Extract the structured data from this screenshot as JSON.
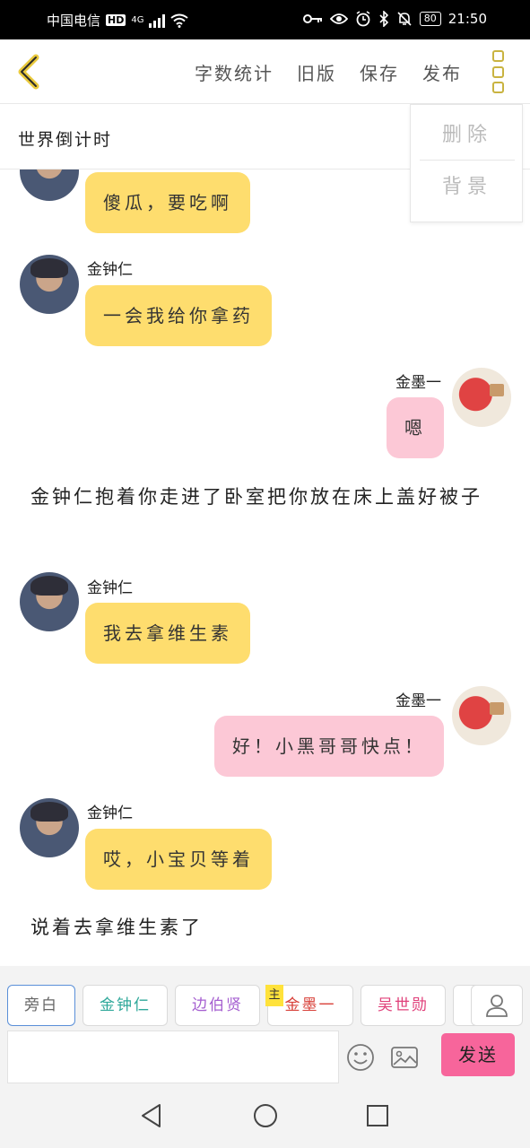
{
  "status_bar": {
    "carrier": "中国电信",
    "hd_badge": "HD",
    "network": "4G",
    "battery": "80",
    "time": "21:50"
  },
  "toolbar": {
    "word_count": "字数统计",
    "old_version": "旧版",
    "save": "保存",
    "publish": "发布"
  },
  "title": "世界倒计时",
  "dropdown_menu": {
    "delete": "删除",
    "background": "背景"
  },
  "messages": [
    {
      "type": "left",
      "name": "",
      "text": "傻瓜，要吃啊"
    },
    {
      "type": "left",
      "name": "金钟仁",
      "text": "一会我给你拿药"
    },
    {
      "type": "right",
      "name": "金墨一",
      "text": "嗯"
    },
    {
      "type": "narration",
      "text": "金钟仁抱着你走进了卧室把你放在床上盖好被子"
    },
    {
      "type": "left",
      "name": "金钟仁",
      "text": "我去拿维生素"
    },
    {
      "type": "right",
      "name": "金墨一",
      "text": "好！小黑哥哥快点！"
    },
    {
      "type": "left",
      "name": "金钟仁",
      "text": "哎，小宝贝等着"
    },
    {
      "type": "narration",
      "text": "说着去拿维生素了"
    }
  ],
  "characters": [
    {
      "label": "旁白",
      "color": "#666666"
    },
    {
      "label": "金钟仁",
      "color": "#2fa89a"
    },
    {
      "label": "边伯贤",
      "color": "#a55fd0"
    },
    {
      "label": "金墨一",
      "color": "#d8413a"
    },
    {
      "label": "吴世勋",
      "color": "#e0407a"
    }
  ],
  "host_tag": "主",
  "send_label": "发送",
  "colors": {
    "bubble_left": "#fedd6e",
    "bubble_right": "#fcc8d6",
    "send_button": "#f7659b",
    "accent_menu": "#c9b340"
  }
}
